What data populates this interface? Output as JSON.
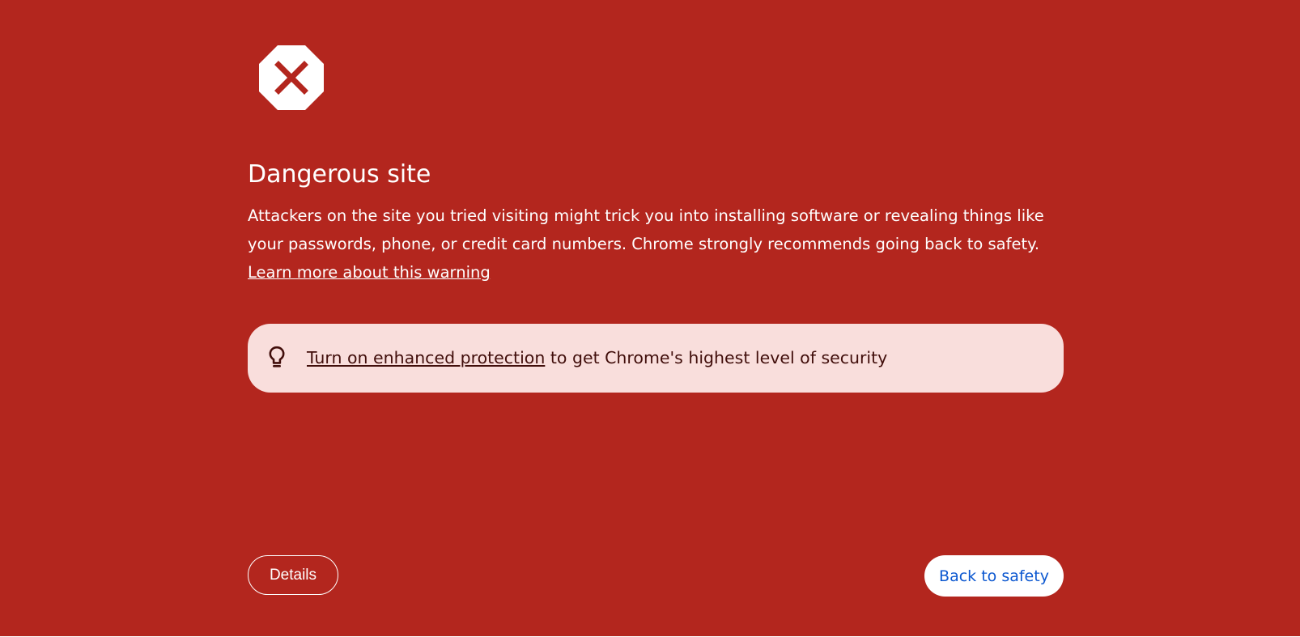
{
  "page": {
    "background_color": "#b3261e"
  },
  "warning_icon": {
    "name": "stop-octagon-x-icon",
    "color": "#ffffff",
    "mark_color": "#b3261e"
  },
  "interstitial": {
    "title": "Dangerous site",
    "description": "Attackers on the site you tried visiting might trick you into installing software or revealing things like your passwords, phone, or credit card numbers. Chrome strongly recommends going back to safety.",
    "learn_more": "Learn more about this warning"
  },
  "enhanced_protection": {
    "icon": "lightbulb-icon",
    "link_text": "Turn on enhanced protection",
    "suffix_text": " to get Chrome's highest level of security",
    "background_color": "#f9dedc",
    "text_color": "#410e0b"
  },
  "actions": {
    "details_label": "Details",
    "back_to_safety_label": "Back to safety",
    "back_to_safety_text_color": "#0b57d0"
  }
}
